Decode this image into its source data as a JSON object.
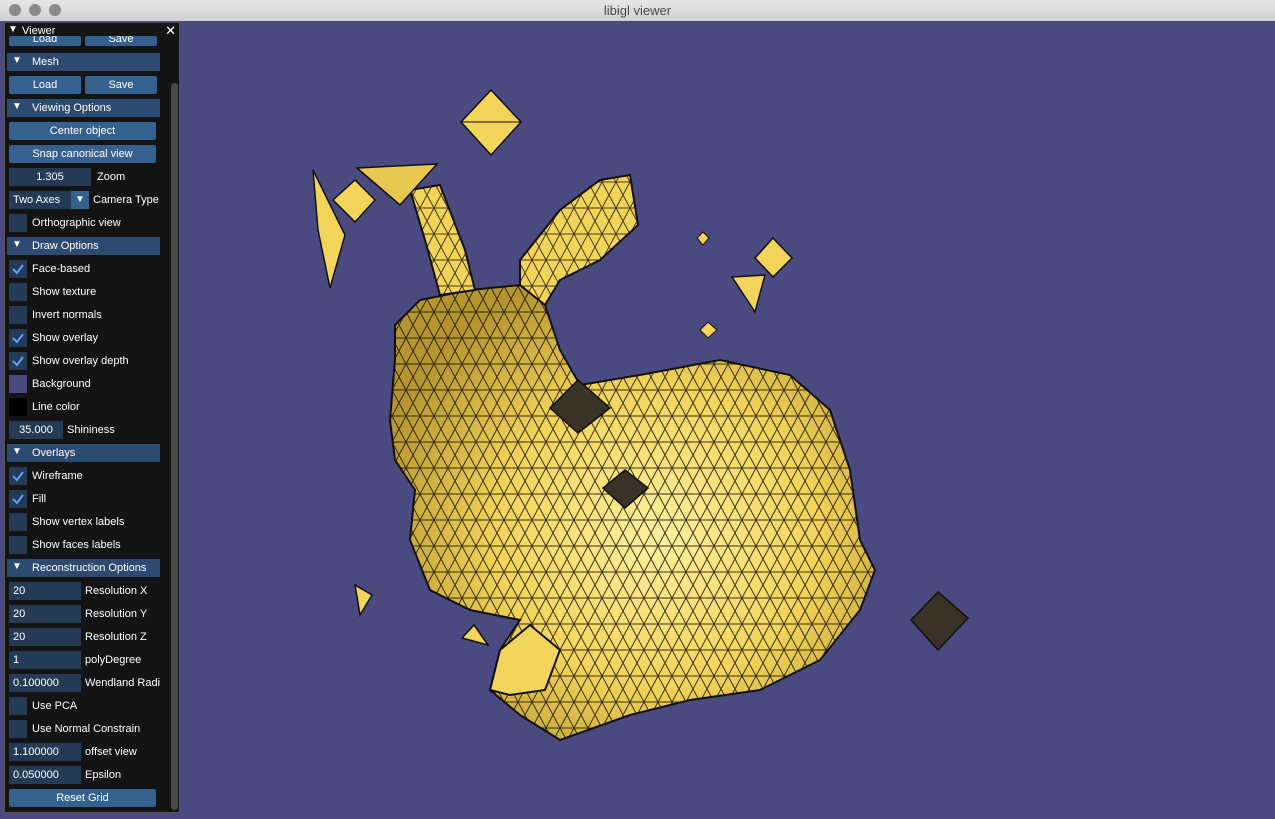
{
  "window": {
    "title": "libigl viewer"
  },
  "panel": {
    "title": "Viewer",
    "top_partial": {
      "load_label": "Load",
      "save_label": "Save"
    },
    "mesh": {
      "header": "Mesh",
      "load_label": "Load",
      "save_label": "Save"
    },
    "viewing": {
      "header": "Viewing Options",
      "center_label": "Center object",
      "snap_label": "Snap canonical view",
      "zoom_value": "1.305",
      "zoom_label": "Zoom",
      "camera_value": "Two Axes",
      "camera_label": "Camera Type",
      "ortho_label": "Orthographic view"
    },
    "draw": {
      "header": "Draw Options",
      "face_based": "Face-based",
      "show_texture": "Show texture",
      "invert_normals": "Invert normals",
      "show_overlay": "Show overlay",
      "show_overlay_depth": "Show overlay depth",
      "background": "Background",
      "line_color": "Line color",
      "shininess_value": "35.000",
      "shininess_label": "Shininess"
    },
    "overlays": {
      "header": "Overlays",
      "wireframe": "Wireframe",
      "fill": "Fill",
      "vertex_labels": "Show vertex labels",
      "face_labels": "Show faces labels"
    },
    "recon": {
      "header": "Reconstruction Options",
      "resx_value": "20",
      "resx_label": "Resolution X",
      "resy_value": "20",
      "resy_label": "Resolution Y",
      "resz_value": "20",
      "resz_label": "Resolution Z",
      "poly_value": "1",
      "poly_label": "polyDegree",
      "wend_value": "0.100000",
      "wend_label": "Wendland Radi",
      "use_pca": "Use PCA",
      "use_normal": "Use Normal Constrain",
      "offset_value": "1.100000",
      "offset_label": "offset view",
      "eps_value": "0.050000",
      "eps_label": "Epsilon",
      "reset_label": "Reset Grid"
    }
  },
  "colors": {
    "background": "#4a4a80",
    "mesh": "#f0d060",
    "line": "#000000",
    "accent": "#35618f"
  },
  "checkbox_state": {
    "face_based": true,
    "show_texture": false,
    "invert_normals": false,
    "show_overlay": true,
    "show_overlay_depth": true,
    "wireframe": true,
    "fill": true,
    "vertex_labels": false,
    "face_labels": false,
    "orthographic": false,
    "use_pca": false,
    "use_normal": false
  }
}
